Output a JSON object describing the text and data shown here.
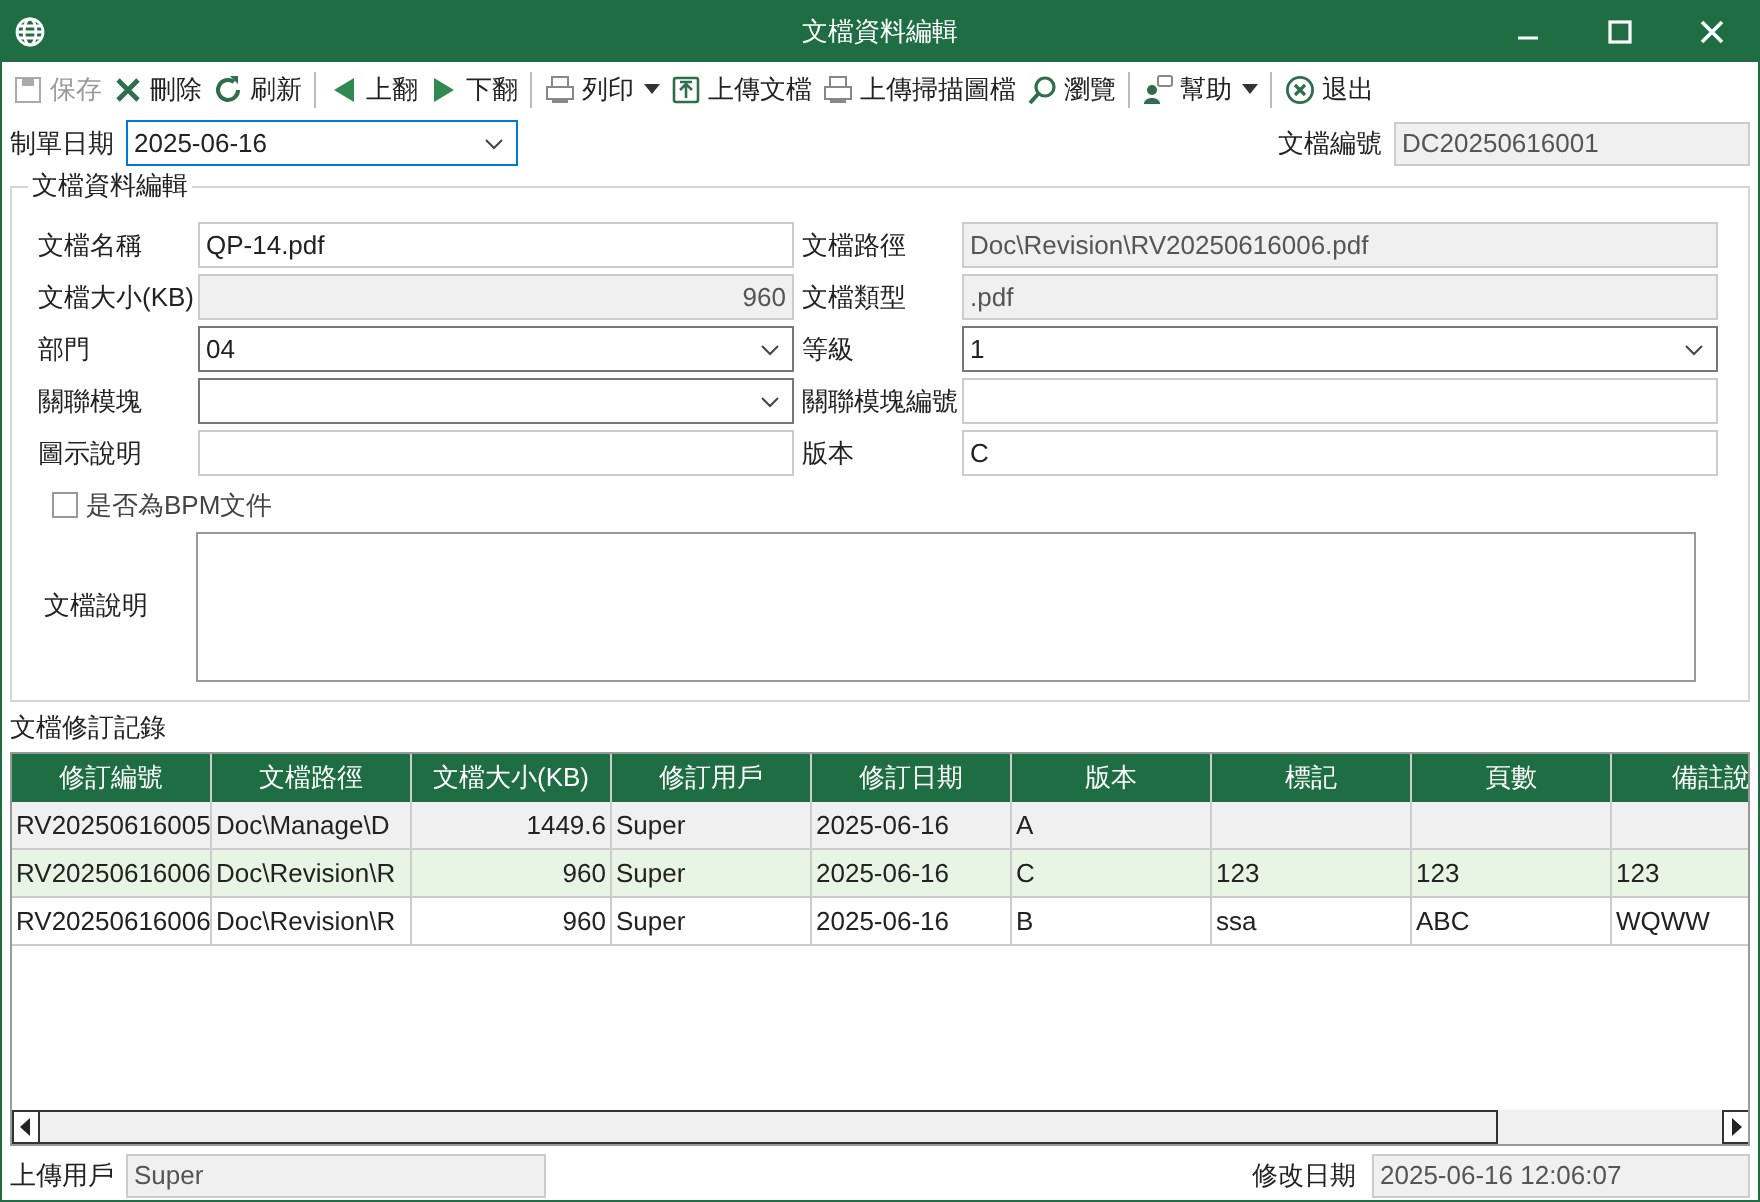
{
  "window": {
    "title": "文檔資料編輯"
  },
  "toolbar": [
    {
      "kind": "button",
      "label": "保存",
      "disabled": true
    },
    {
      "kind": "button",
      "label": "刪除",
      "disabled": false
    },
    {
      "kind": "button",
      "label": "刷新",
      "disabled": false
    },
    {
      "kind": "separator"
    },
    {
      "kind": "button",
      "label": "上翻",
      "disabled": false
    },
    {
      "kind": "button",
      "label": "下翻",
      "disabled": false
    },
    {
      "kind": "separator"
    },
    {
      "kind": "dropdown",
      "label": "列印",
      "disabled": false
    },
    {
      "kind": "button",
      "label": "上傳文檔",
      "disabled": false
    },
    {
      "kind": "button",
      "label": "上傳掃描圖檔",
      "disabled": false
    },
    {
      "kind": "button",
      "label": "瀏覽",
      "disabled": false
    },
    {
      "kind": "separator"
    },
    {
      "kind": "dropdown",
      "label": "幫助",
      "disabled": false
    },
    {
      "kind": "separator"
    },
    {
      "kind": "button",
      "label": "退出",
      "disabled": false
    }
  ],
  "header": {
    "date": {
      "label": "制單日期",
      "value": "2025-06-16",
      "focused": true
    },
    "number": {
      "label": "文檔編號",
      "value": "DC20250616001"
    }
  },
  "group": {
    "title": "文檔資料編輯",
    "fields": [
      {
        "label": "文檔名稱",
        "kind": "text",
        "value": "QP-14.pdf",
        "readonly": false
      },
      {
        "label": "文檔路徑",
        "kind": "text",
        "value": "Doc\\Revision\\RV20250616006.pdf",
        "readonly": true
      },
      {
        "label": "文檔大小(KB)",
        "kind": "number",
        "value": "960",
        "readonly": true
      },
      {
        "label": "文檔類型",
        "kind": "text",
        "value": ".pdf",
        "readonly": true
      },
      {
        "label": "部門",
        "kind": "select",
        "value": "04",
        "readonly": false
      },
      {
        "label": "等級",
        "kind": "select",
        "value": "1",
        "readonly": false
      },
      {
        "label": "關聯模塊",
        "kind": "select",
        "readonly": false
      },
      {
        "label": "關聯模塊編號",
        "kind": "text",
        "readonly": false
      },
      {
        "label": "圖示說明",
        "kind": "text",
        "readonly": false
      },
      {
        "label": "版本",
        "kind": "text",
        "value": "C",
        "readonly": false
      }
    ],
    "bpm": {
      "label": "是否為BPM文件",
      "checked": false
    },
    "description": {
      "label": "文檔說明"
    }
  },
  "history": {
    "title": "文檔修訂記錄",
    "columns": [
      "修訂編號",
      "文檔路徑",
      "文檔大小(KB)",
      "修訂用戶",
      "修訂日期",
      "版本",
      "標記",
      "頁數",
      "備註說"
    ],
    "rows": [
      {
        "selected": true,
        "cells": [
          "RV20250616005",
          "Doc\\Manage\\D",
          "1449.6",
          "Super",
          "2025-06-16",
          "A",
          "",
          "",
          ""
        ]
      },
      {
        "selected": false,
        "cells": [
          "RV20250616006",
          "Doc\\Revision\\R",
          "960",
          "Super",
          "2025-06-16",
          "C",
          "123",
          "123",
          "123"
        ]
      },
      {
        "selected": false,
        "cells": [
          "RV20250616006",
          "Doc\\Revision\\R",
          "960",
          "Super",
          "2025-06-16",
          "B",
          "ssa",
          "ABC",
          "WQWW"
        ]
      }
    ]
  },
  "footer": {
    "user": {
      "label": "上傳用戶",
      "value": "Super"
    },
    "modified": {
      "label": "修改日期",
      "value": "2025-06-16 12:06:07"
    }
  }
}
